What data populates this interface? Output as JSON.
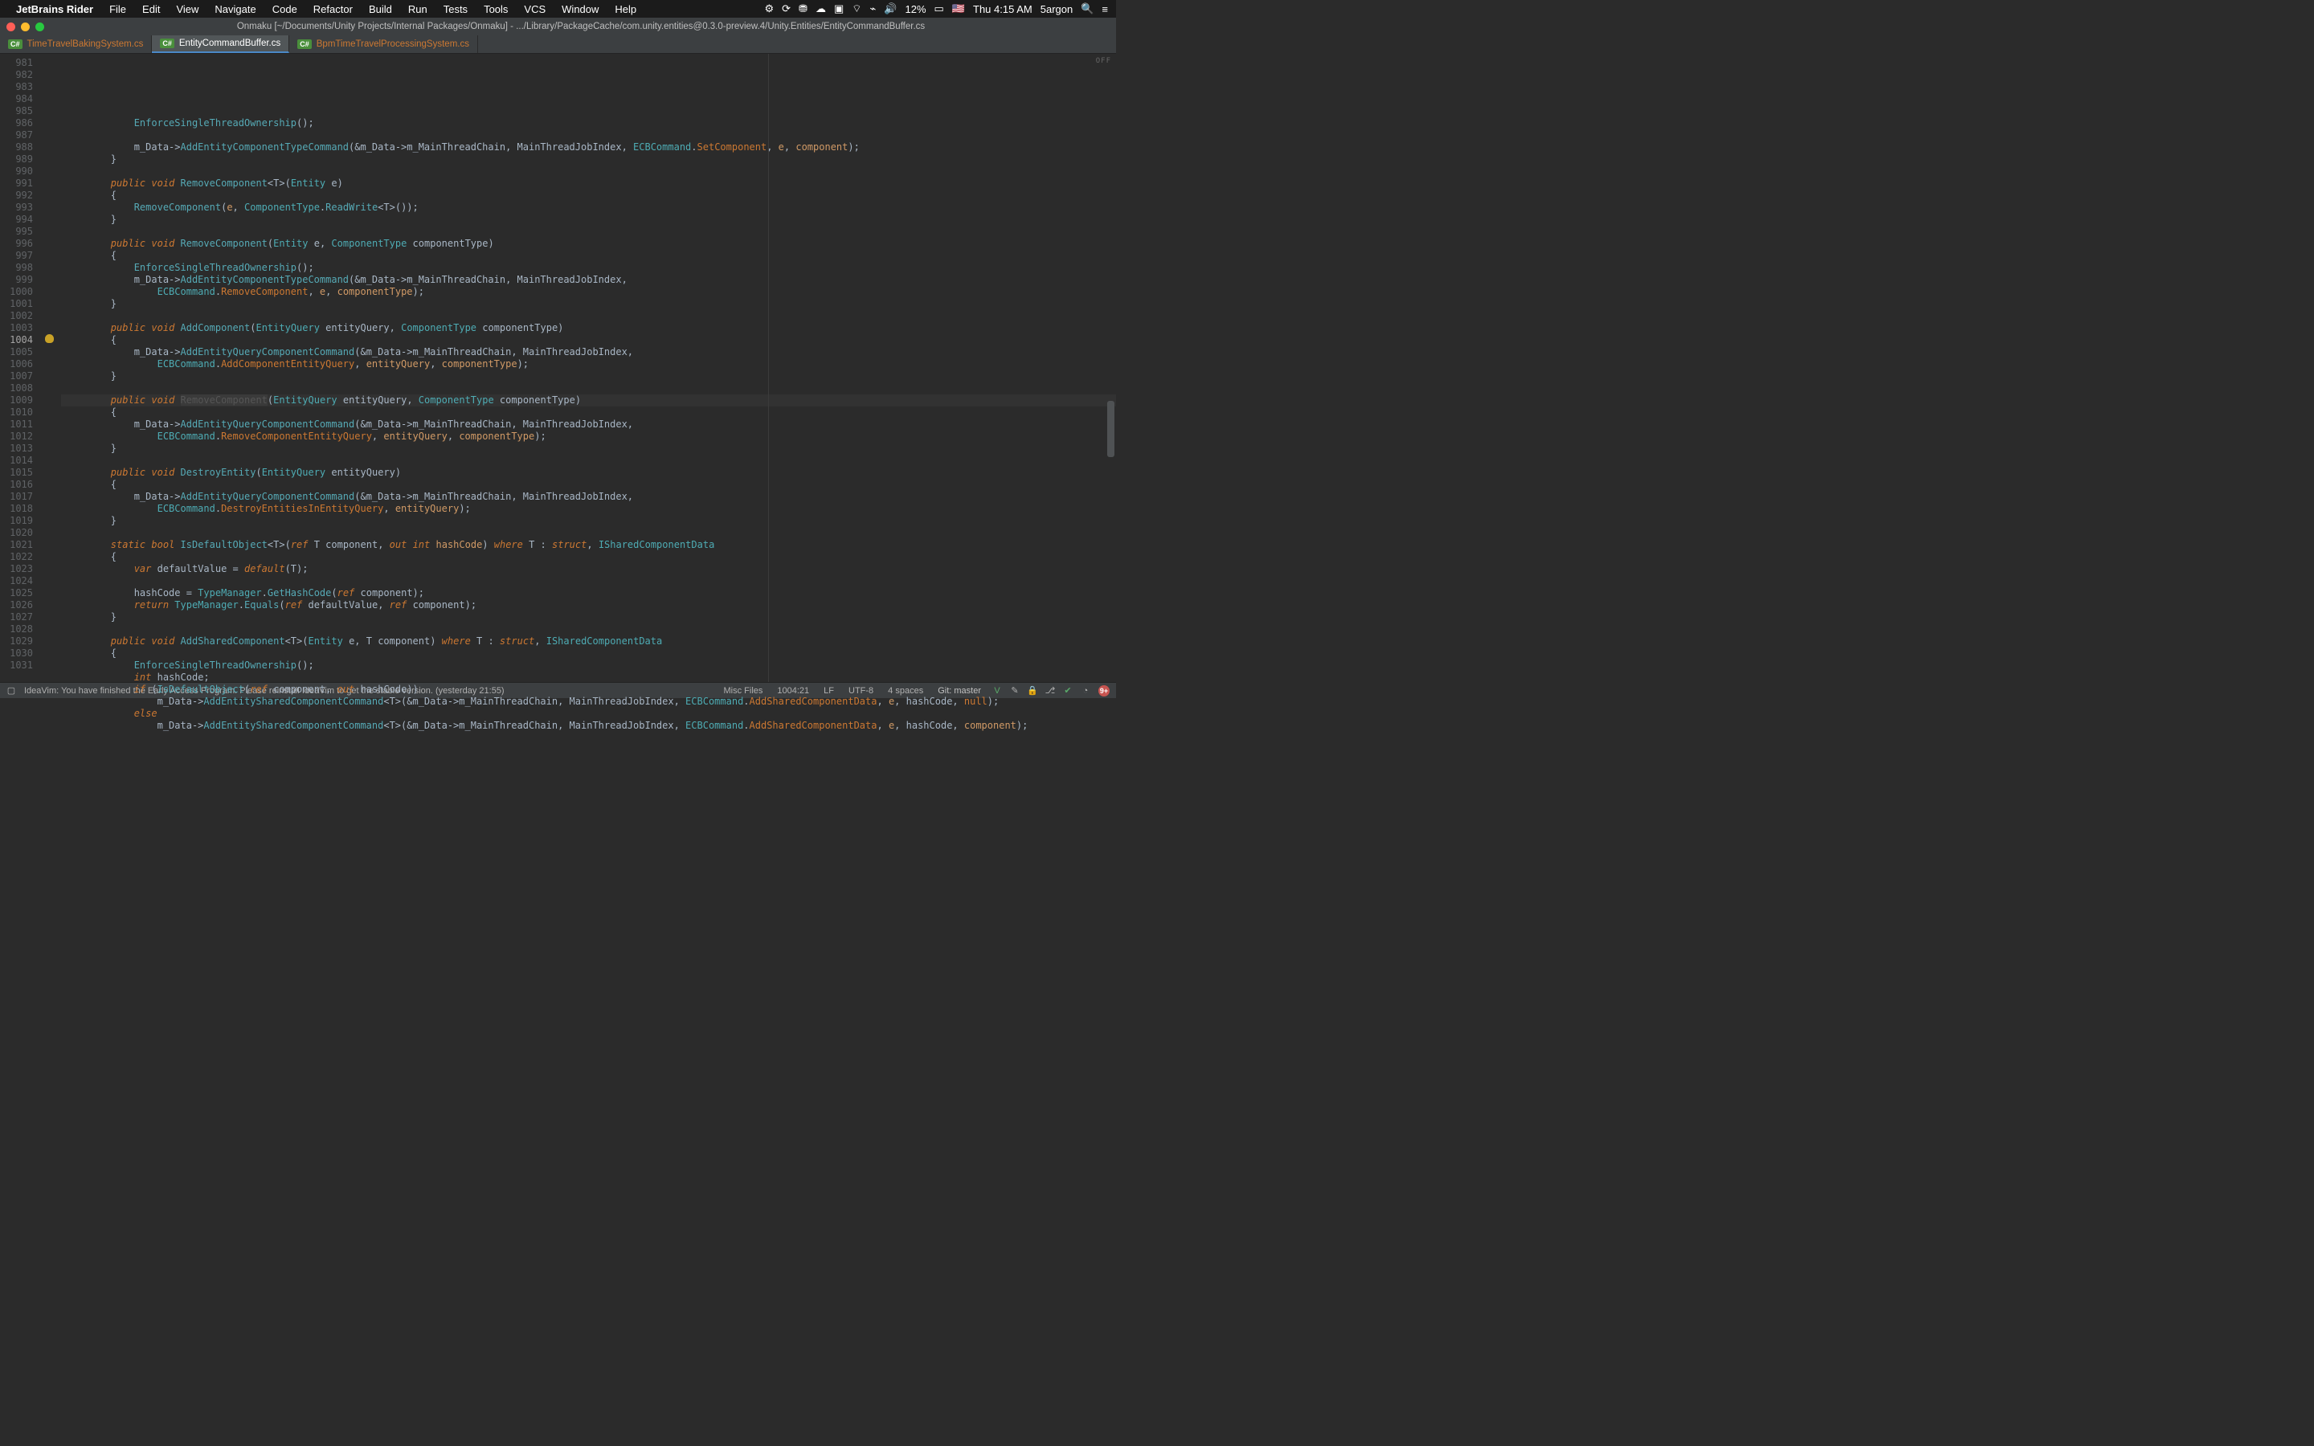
{
  "mac_menu": {
    "app_name": "JetBrains Rider",
    "items": [
      "File",
      "Edit",
      "View",
      "Navigate",
      "Code",
      "Refactor",
      "Build",
      "Run",
      "Tests",
      "Tools",
      "VCS",
      "Window",
      "Help"
    ],
    "sys": {
      "battery": "12%",
      "clock": "Thu 4:15 AM",
      "user": "5argon"
    }
  },
  "window_title": "Onmaku [~/Documents/Unity Projects/Internal Packages/Onmaku] - .../Library/PackageCache/com.unity.entities@0.3.0-preview.4/Unity.Entities/EntityCommandBuffer.cs",
  "tabs": [
    {
      "lang": "C#",
      "label": "TimeTravelBakingSystem.cs",
      "active": false,
      "dim": true
    },
    {
      "lang": "C#",
      "label": "EntityCommandBuffer.cs",
      "active": true,
      "dim": false
    },
    {
      "lang": "C#",
      "label": "BpmTimeTravelProcessingSystem.cs",
      "active": false,
      "dim": true
    }
  ],
  "editor_off_label": "OFF",
  "line_start": 981,
  "line_end": 1031,
  "active_line": 1004,
  "statusbar": {
    "message": "IdeaVim: You have finished the Early Access Program. Please reinstall IdeaVim to get the stable version. (yesterday 21:55)",
    "misc": "Misc Files",
    "pos": "1004:21",
    "eol": "LF",
    "enc": "UTF-8",
    "indent": "4 spaces",
    "branch": "Git: master",
    "problems": "9+"
  },
  "code": [
    {
      "n": 981,
      "html": "            <span class='c-meth'>EnforceSingleThreadOwnership</span>();"
    },
    {
      "n": 982,
      "html": ""
    },
    {
      "n": 983,
      "html": "            m_Data-><span class='c-meth'>AddEntityComponentTypeCommand</span>(&amp;m_Data->m_MainThreadChain, MainThreadJobIndex, <span class='c-type'>ECBCommand</span>.<span class='c-enum'>SetComponent</span>, <span class='c-field'>e</span>, <span class='c-field'>component</span>);"
    },
    {
      "n": 984,
      "html": "        }"
    },
    {
      "n": 985,
      "html": ""
    },
    {
      "n": 986,
      "html": "        <span class='c-kw'>public</span> <span class='c-kw'>void</span> <span class='c-meth'>RemoveComponent</span>&lt;T&gt;(<span class='c-type'>Entity</span> e)"
    },
    {
      "n": 987,
      "html": "        {"
    },
    {
      "n": 988,
      "html": "            <span class='c-meth'>RemoveComponent</span>(<span class='c-field'>e</span>, <span class='c-type'>ComponentType</span>.<span class='c-meth'>ReadWrite</span>&lt;T&gt;());"
    },
    {
      "n": 989,
      "html": "        }"
    },
    {
      "n": 990,
      "html": ""
    },
    {
      "n": 991,
      "html": "        <span class='c-kw'>public</span> <span class='c-kw'>void</span> <span class='c-meth'>RemoveComponent</span>(<span class='c-type'>Entity</span> e, <span class='c-type'>ComponentType</span> componentType)"
    },
    {
      "n": 992,
      "html": "        {"
    },
    {
      "n": 993,
      "html": "            <span class='c-meth'>EnforceSingleThreadOwnership</span>();"
    },
    {
      "n": 994,
      "html": "            m_Data-><span class='c-meth'>AddEntityComponentTypeCommand</span>(&amp;m_Data->m_MainThreadChain, MainThreadJobIndex,"
    },
    {
      "n": 995,
      "html": "                <span class='c-type'>ECBCommand</span>.<span class='c-enum'>RemoveComponent</span>, <span class='c-field'>e</span>, <span class='c-field'>componentType</span>);"
    },
    {
      "n": 996,
      "html": "        }"
    },
    {
      "n": 997,
      "html": ""
    },
    {
      "n": 998,
      "html": "        <span class='c-kw'>public</span> <span class='c-kw'>void</span> <span class='c-meth'>AddComponent</span>(<span class='c-type'>EntityQuery</span> entityQuery, <span class='c-type'>ComponentType</span> componentType)"
    },
    {
      "n": 999,
      "html": "        {"
    },
    {
      "n": 1000,
      "html": "            m_Data-><span class='c-meth'>AddEntityQueryComponentCommand</span>(&amp;m_Data->m_MainThreadChain, MainThreadJobIndex,"
    },
    {
      "n": 1001,
      "html": "                <span class='c-type'>ECBCommand</span>.<span class='c-enum'>AddComponentEntityQuery</span>, <span class='c-field'>entityQuery</span>, <span class='c-field'>componentType</span>);"
    },
    {
      "n": 1002,
      "html": "        }"
    },
    {
      "n": 1003,
      "html": ""
    },
    {
      "n": 1004,
      "html": "        <span class='c-kw'>public</span> <span class='c-kw'>void</span> <span class='c-ghost'>RemoveComponent</span>(<span class='c-type'>EntityQuery</span> entityQuery, <span class='c-type'>ComponentType</span> componentType)",
      "hl": true,
      "bulb": true
    },
    {
      "n": 1005,
      "html": "        {"
    },
    {
      "n": 1006,
      "html": "            m_Data-><span class='c-meth'>AddEntityQueryComponentCommand</span>(&amp;m_Data->m_MainThreadChain, MainThreadJobIndex,"
    },
    {
      "n": 1007,
      "html": "                <span class='c-type'>ECBCommand</span>.<span class='c-enum'>RemoveComponentEntityQuery</span>, <span class='c-field'>entityQuery</span>, <span class='c-field'>componentType</span>);"
    },
    {
      "n": 1008,
      "html": "        }"
    },
    {
      "n": 1009,
      "html": ""
    },
    {
      "n": 1010,
      "html": "        <span class='c-kw'>public</span> <span class='c-kw'>void</span> <span class='c-meth'>DestroyEntity</span>(<span class='c-type'>EntityQuery</span> entityQuery)"
    },
    {
      "n": 1011,
      "html": "        {"
    },
    {
      "n": 1012,
      "html": "            m_Data-><span class='c-meth'>AddEntityQueryComponentCommand</span>(&amp;m_Data->m_MainThreadChain, MainThreadJobIndex,"
    },
    {
      "n": 1013,
      "html": "                <span class='c-type'>ECBCommand</span>.<span class='c-enum'>DestroyEntitiesInEntityQuery</span>, <span class='c-field'>entityQuery</span>);"
    },
    {
      "n": 1014,
      "html": "        }"
    },
    {
      "n": 1015,
      "html": ""
    },
    {
      "n": 1016,
      "html": "        <span class='c-kw'>static</span> <span class='c-kw'>bool</span> <span class='c-meth'>IsDefaultObject</span>&lt;T&gt;(<span class='c-kw'>ref</span> T component, <span class='c-kw'>out</span> <span class='c-kw'>int</span> <span class='c-field'>hashCode</span>) <span class='c-kw'>where</span> T : <span class='c-kw'>struct</span>, <span class='c-type'>ISharedComponentData</span>"
    },
    {
      "n": 1017,
      "html": "        {"
    },
    {
      "n": 1018,
      "html": "            <span class='c-kw'>var</span> defaultValue = <span class='c-kw'>default</span>(T);"
    },
    {
      "n": 1019,
      "html": ""
    },
    {
      "n": 1020,
      "html": "            hashCode = <span class='c-type'>TypeManager</span>.<span class='c-meth'>GetHashCode</span>(<span class='c-kw'>ref</span> component);"
    },
    {
      "n": 1021,
      "html": "            <span class='c-kw'>return</span> <span class='c-type'>TypeManager</span>.<span class='c-meth'>Equals</span>(<span class='c-kw'>ref</span> defaultValue, <span class='c-kw'>ref</span> component);"
    },
    {
      "n": 1022,
      "html": "        }"
    },
    {
      "n": 1023,
      "html": ""
    },
    {
      "n": 1024,
      "html": "        <span class='c-kw'>public</span> <span class='c-kw'>void</span> <span class='c-meth'>AddSharedComponent</span>&lt;T&gt;(<span class='c-type'>Entity</span> e, T component) <span class='c-kw'>where</span> T : <span class='c-kw'>struct</span>, <span class='c-type'>ISharedComponentData</span>"
    },
    {
      "n": 1025,
      "html": "        {"
    },
    {
      "n": 1026,
      "html": "            <span class='c-meth'>EnforceSingleThreadOwnership</span>();"
    },
    {
      "n": 1027,
      "html": "            <span class='c-kw'>int</span> hashCode;"
    },
    {
      "n": 1028,
      "html": "            <span class='c-kw'>if</span> (<span class='c-meth'>IsDefaultObject</span>(<span class='c-kw'>ref</span> component, <span class='c-kw'>out</span> hashCode))"
    },
    {
      "n": 1029,
      "html": "                m_Data-><span class='c-meth'>AddEntitySharedComponentCommand</span>&lt;T&gt;(&amp;m_Data->m_MainThreadChain, MainThreadJobIndex, <span class='c-type'>ECBCommand</span>.<span class='c-enum'>AddSharedComponentData</span>, <span class='c-field'>e</span>, hashCode, <span class='c-null'>null</span>);"
    },
    {
      "n": 1030,
      "html": "            <span class='c-kw'>else</span>"
    },
    {
      "n": 1031,
      "html": "                m_Data-><span class='c-meth'>AddEntitySharedComponentCommand</span>&lt;T&gt;(&amp;m_Data->m_MainThreadChain, MainThreadJobIndex, <span class='c-type'>ECBCommand</span>.<span class='c-enum'>AddSharedComponentData</span>, <span class='c-field'>e</span>, hashCode, <span class='c-field'>component</span>);"
    }
  ]
}
